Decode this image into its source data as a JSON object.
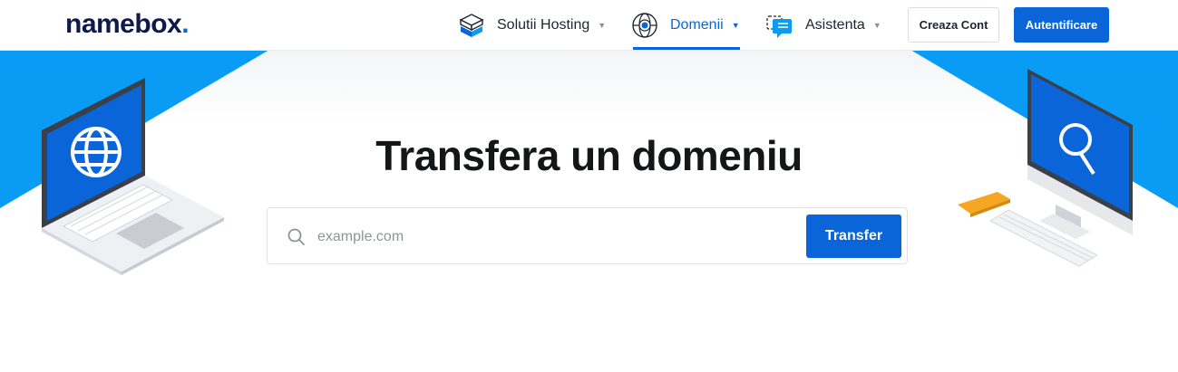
{
  "header": {
    "logo_text": "namebox",
    "logo_dot": ".",
    "nav": [
      {
        "label": "Solutii Hosting",
        "icon": "server-box-icon"
      },
      {
        "label": "Domenii",
        "icon": "globe-target-icon",
        "active": true
      },
      {
        "label": "Asistenta",
        "icon": "chat-bubbles-icon"
      }
    ],
    "caret": "▼",
    "create_account_label": "Creaza Cont",
    "login_label": "Autentificare"
  },
  "hero": {
    "title": "Transfera un domeniu",
    "search_placeholder": "example.com",
    "search_value": "",
    "transfer_label": "Transfer"
  },
  "colors": {
    "accent": "#0a66d8",
    "hero_blue": "#0a9cf5",
    "logo_navy": "#0d1b4c"
  }
}
